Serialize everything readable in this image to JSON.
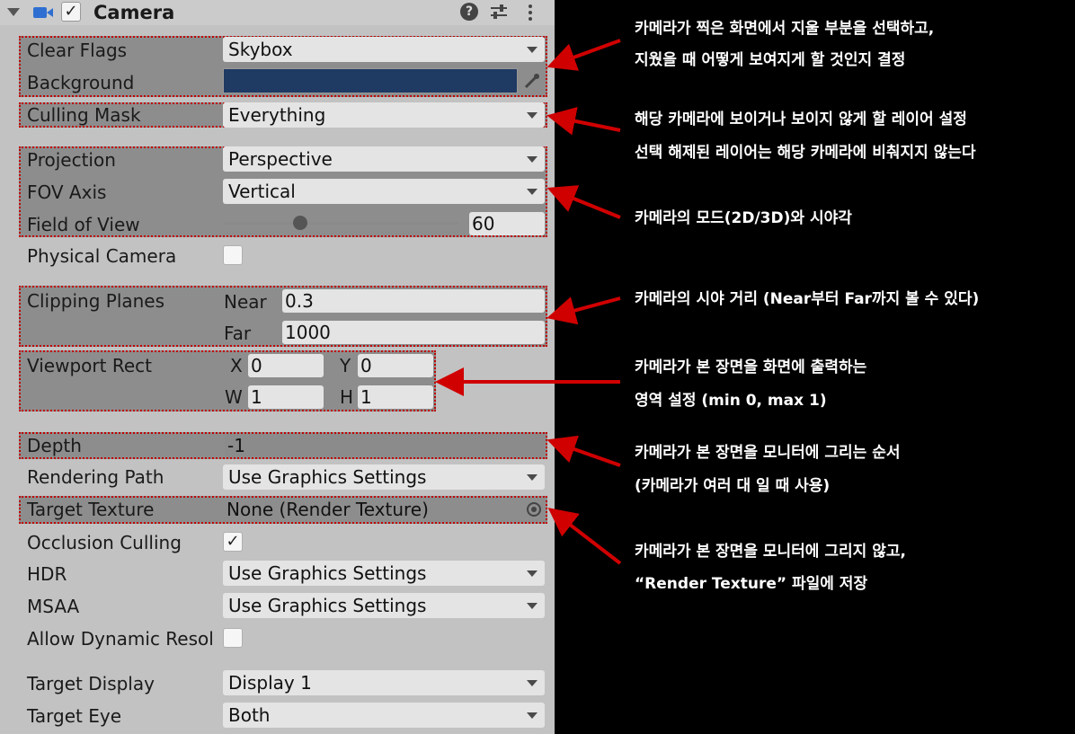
{
  "header": {
    "title": "Camera",
    "icons": [
      "collapse-arrow-icon",
      "camera-icon",
      "enabled-checkbox-icon",
      "help-icon",
      "preset-icon",
      "more-icon"
    ]
  },
  "fields": {
    "clear_flags": {
      "label": "Clear Flags",
      "value": "Skybox"
    },
    "background": {
      "label": "Background",
      "color": "#1f3a63"
    },
    "culling_mask": {
      "label": "Culling Mask",
      "value": "Everything"
    },
    "projection": {
      "label": "Projection",
      "value": "Perspective"
    },
    "fov_axis": {
      "label": "FOV Axis",
      "value": "Vertical"
    },
    "field_of_view": {
      "label": "Field of View",
      "value": "60",
      "slider_fraction": 0.33
    },
    "physical_camera": {
      "label": "Physical Camera",
      "checked": false
    },
    "clipping_planes": {
      "label": "Clipping Planes",
      "near_label": "Near",
      "near": "0.3",
      "far_label": "Far",
      "far": "1000"
    },
    "viewport_rect": {
      "label": "Viewport Rect",
      "x_label": "X",
      "x": "0",
      "y_label": "Y",
      "y": "0",
      "w_label": "W",
      "w": "1",
      "h_label": "H",
      "h": "1"
    },
    "depth": {
      "label": "Depth",
      "value": "-1"
    },
    "rendering_path": {
      "label": "Rendering Path",
      "value": "Use Graphics Settings"
    },
    "target_texture": {
      "label": "Target Texture",
      "value": "None (Render Texture)"
    },
    "occlusion_culling": {
      "label": "Occlusion Culling",
      "check": "✓"
    },
    "hdr": {
      "label": "HDR",
      "value": "Use Graphics Settings"
    },
    "msaa": {
      "label": "MSAA",
      "value": "Use Graphics Settings"
    },
    "allow_dynamic": {
      "label": "Allow Dynamic Resol",
      "checked": false
    },
    "target_display": {
      "label": "Target Display",
      "value": "Display 1"
    },
    "target_eye": {
      "label": "Target Eye",
      "value": "Both"
    }
  },
  "annotations": {
    "clear_flags_1": "카메라가 찍은 화면에서 지울 부분을 선택하고,",
    "clear_flags_2": "지웠을 때 어떻게 보여지게 할 것인지 결정",
    "culling_1": "해당 카메라에 보이거나 보이지 않게 할 레이어 설정",
    "culling_2": "선택 해제된 레이어는 해당 카메라에 비춰지지 않는다",
    "projection": "카메라의 모드(2D/3D)와 시야각",
    "clipping": "카메라의 시야 거리 (Near부터 Far까지 볼 수 있다)",
    "viewport_1": "카메라가 본 장면을 화면에 출력하는",
    "viewport_2": "영역 설정 (min 0, max 1)",
    "depth_1": "카메라가 본 장면을 모니터에 그리는 순서",
    "depth_2": "(카메라가 여러 대 일 때 사용)",
    "target_1": "카메라가 본 장면을 모니터에 그리지 않고,",
    "target_2": "“Render Texture” 파일에 저장"
  },
  "colors": {
    "highlight_border": "#c00000",
    "arrow": "#d00000",
    "panel": "#c2c2c2",
    "field": "#e4e4e4"
  }
}
